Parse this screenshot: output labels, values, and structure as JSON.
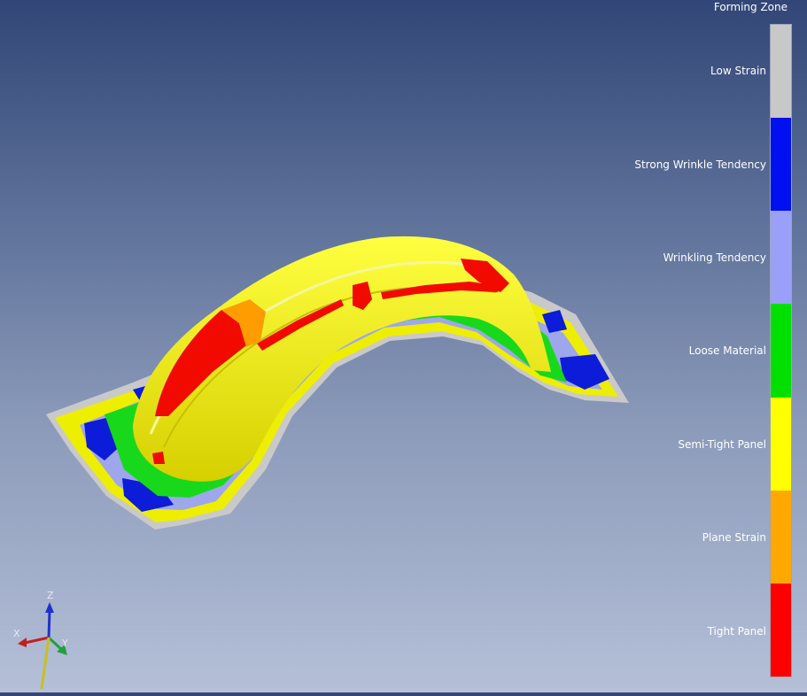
{
  "legend": {
    "title": "Forming Zone",
    "items": [
      {
        "label": "Low Strain",
        "color": "#c8c8c8"
      },
      {
        "label": "Strong Wrinkle Tendency",
        "color": "#0010f0"
      },
      {
        "label": "Wrinkling Tendency",
        "color": "#9aa0f8"
      },
      {
        "label": "Loose Material",
        "color": "#00e000"
      },
      {
        "label": "Semi-Tight Panel",
        "color": "#ffff00"
      },
      {
        "label": "Plane Strain",
        "color": "#ffa800"
      },
      {
        "label": "Tight Panel",
        "color": "#ff0000"
      }
    ]
  },
  "axes": {
    "x": "X",
    "y": "Y",
    "z": "Z"
  }
}
